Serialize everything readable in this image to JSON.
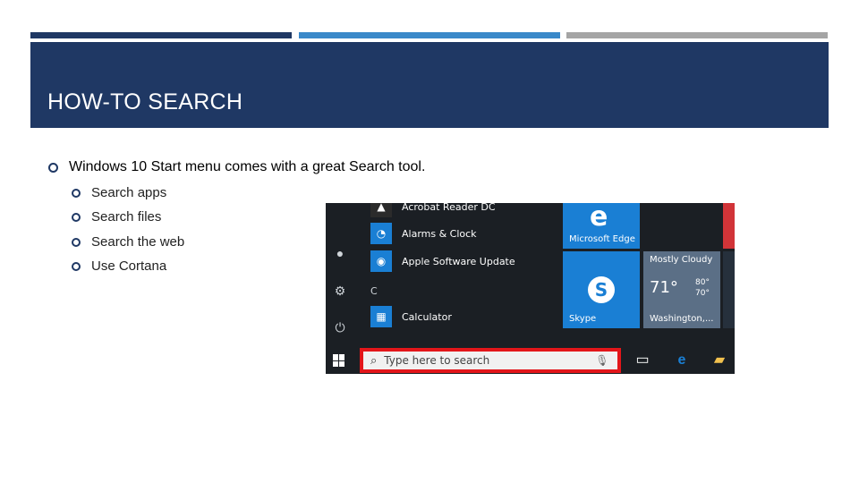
{
  "slide": {
    "title": "HOW-TO SEARCH",
    "bullets": [
      "Windows 10 Start menu comes with a great Search tool.",
      "Search apps",
      "Search files",
      "Search the web",
      "Use Cortana"
    ]
  },
  "screenshot": {
    "apps": [
      {
        "name": "Acrobat Reader DC",
        "icon": "acrobat-icon"
      },
      {
        "name": "Alarms & Clock",
        "icon": "alarm-icon"
      },
      {
        "name": "Apple Software Update",
        "icon": "apple-update-icon"
      },
      {
        "name": "Calculator",
        "icon": "calculator-icon"
      }
    ],
    "section_letter": "C",
    "tiles": {
      "edge_label": "Microsoft Edge",
      "skype_label": "Skype",
      "weather_title": "Mostly Cloudy",
      "weather_temp": "71°",
      "weather_hi": "80°",
      "weather_lo": "70°",
      "weather_city": "Washington,..."
    },
    "search_placeholder": "Type here to search",
    "colors": {
      "highlight": "#e3161a",
      "tile_blue": "#1a7fd4",
      "slide_navy": "#1f3864"
    }
  }
}
